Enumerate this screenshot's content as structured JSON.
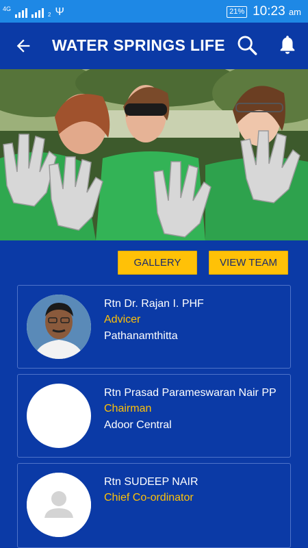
{
  "status_bar": {
    "network_label": "4G",
    "sim2_label": "2",
    "battery": "21%",
    "time": "10:23",
    "ampm": "am"
  },
  "app_bar": {
    "title": "WATER SPRINGS LIFE",
    "back_icon": "arrow-back-icon",
    "search_icon": "search-icon",
    "bell_icon": "bell-icon"
  },
  "actions": {
    "gallery_label": "GALLERY",
    "view_team_label": "VIEW TEAM"
  },
  "members": [
    {
      "name": "Rtn Dr. Rajan I.  PHF",
      "role": "Advicer",
      "place": "Pathanamthitta"
    },
    {
      "name": "Rtn  Prasad Parameswaran Nair PP",
      "role": "Chairman",
      "place": "Adoor Central"
    },
    {
      "name": "Rtn  SUDEEP NAIR",
      "role": "Chief Co-ordinator",
      "place": ""
    }
  ],
  "colors": {
    "status_bar": "#1e88e5",
    "background": "#0b3aa6",
    "accent_button": "#ffc107",
    "role_text": "#ffc107"
  }
}
